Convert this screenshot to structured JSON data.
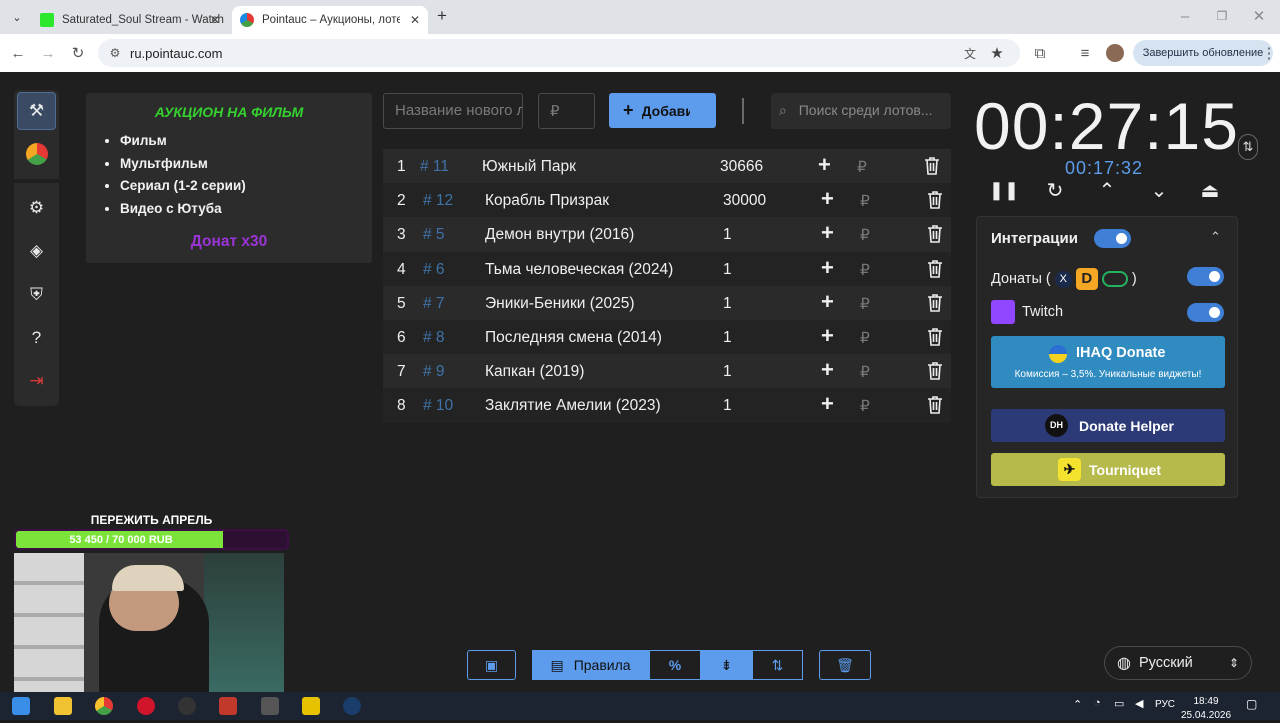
{
  "browser": {
    "tabs": [
      {
        "label": "Saturated_Soul Stream - Watch"
      },
      {
        "label": "Pointauc – Аукционы, лотереи"
      }
    ],
    "url": "ru.pointauc.com",
    "update_label": "Завершить обновление"
  },
  "rules_panel": {
    "title": "АУКЦИОН НА ФИЛЬМ",
    "items": [
      "Фильм",
      "Мультфильм",
      "Сериал (1-2 серии)",
      "Видео с Ютуба"
    ],
    "donation": "Донат х30"
  },
  "new_lot": {
    "name_placeholder": "Название нового лота",
    "amount_placeholder": "₽",
    "add_label": "Добавить"
  },
  "search": {
    "placeholder": "Поиск среди лотов..."
  },
  "lots": [
    {
      "n": "1",
      "id": "# 11",
      "name": "Южный Парк",
      "amount": "30666"
    },
    {
      "n": "2",
      "id": "# 12",
      "name": "Корабль Призрак",
      "amount": "30000"
    },
    {
      "n": "3",
      "id": "# 5",
      "name": "Демон внутри (2016)",
      "amount": "1"
    },
    {
      "n": "4",
      "id": "# 6",
      "name": "Тьма человеческая (2024)",
      "amount": "1"
    },
    {
      "n": "5",
      "id": "# 7",
      "name": "Эники-Беники (2025)",
      "amount": "1"
    },
    {
      "n": "6",
      "id": "# 8",
      "name": "Последняя смена (2014)",
      "amount": "1"
    },
    {
      "n": "7",
      "id": "# 9",
      "name": "Капкан (2019)",
      "amount": "1"
    },
    {
      "n": "8",
      "id": "# 10",
      "name": "Заклятие Амелии (2023)",
      "amount": "1"
    }
  ],
  "lot_currency": "₽",
  "timer": {
    "main": "00:27:15",
    "sub": "00:17:32"
  },
  "integrations": {
    "title": "Интеграции",
    "donations_label": "Донаты (",
    "donations_close": ")",
    "twitch_label": "Twitch",
    "ihaq": {
      "title": "IHAQ Donate",
      "subtitle": "Комиссия – 3,5%. Уникальные виджеты!"
    },
    "donate_helper": "Donate Helper",
    "tourniquet": "Tourniquet"
  },
  "bottom_bar": {
    "rules_label": "Правила"
  },
  "language": "Русский",
  "stream_overlay": {
    "goal_title": "ПЕРЕЖИТЬ АПРЕЛЬ",
    "goal_text": "53 450 / 70 000 RUB",
    "goal_progress": 0.764
  },
  "taskbar": {
    "lang": "РУС",
    "time": "18:49",
    "date": "25.04.2026"
  },
  "colors": {
    "accent": "#5d9cec",
    "rules_title": "#35d12e",
    "donation": "#9b34d6",
    "goal_fill": "#7ce33a",
    "ihaq": "#2f8bc0",
    "donate_helper": "#2c3a78",
    "tourniquet": "#b6ba4a"
  }
}
